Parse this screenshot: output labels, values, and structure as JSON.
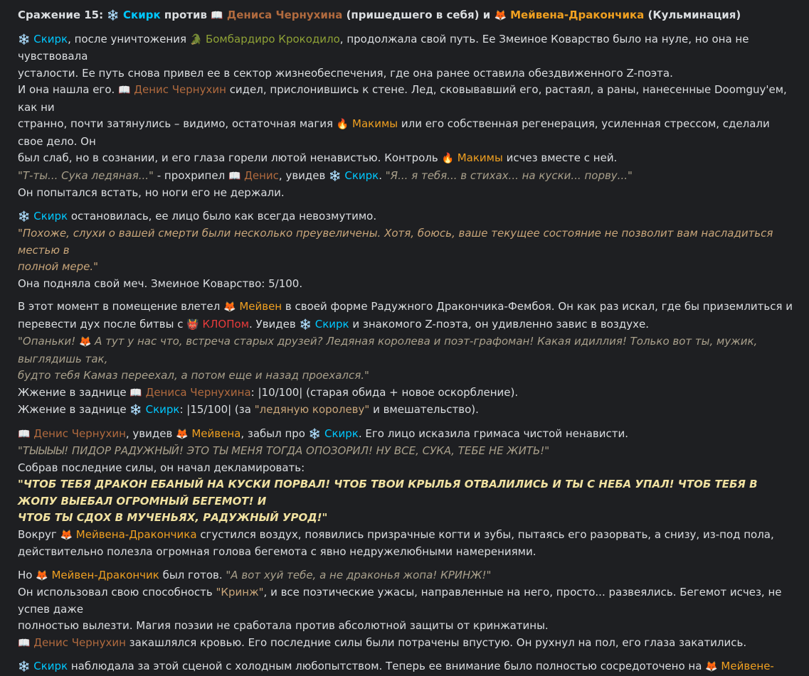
{
  "title": {
    "prefix": "Сражение 15: ",
    "skirk": "Скирк",
    "vs": " против ",
    "denis": "Дениса Чернухина",
    "mid": " (пришедшего в себя) и ",
    "meyven": "Мейвена-Дракончика",
    "suffix": " (Кульминация)"
  },
  "icons": {
    "skirk": "❄️",
    "denis": "📖",
    "meyven": "🦊",
    "maxim": "🔥",
    "croc": "🐊",
    "klop": "👹"
  },
  "p1": {
    "skirk": "Скирк",
    "t1": ", после уничтожения ",
    "croc": "Бомбардиро Крокодило",
    "t2": ", продолжала свой путь. Ее Змеиное Коварство было на нуле, но она не чувствовала",
    "t3": "усталости. Ее путь снова привел ее в сектор жизнеобеспечения, где она ранее оставила обездвиженного Z-поэта.",
    "t4": "И она нашла его. ",
    "denis": "Денис Чернухин",
    "t5": " сидел, прислонившись к стене. Лед, сковывавший его, растаял, а раны, нанесенные Doomguy'ем, как ни",
    "t6": "странно, почти затянулись – видимо, остаточная магия ",
    "maxim1": "Макимы",
    "t7": " или его собственная регенерация, усиленная стрессом, сделали свое дело. Он",
    "t8": "был слаб, но в сознании, и его глаза горели лютой ненавистью. Контроль ",
    "maxim2": "Макимы",
    "t9": " исчез вместе с ней.",
    "q1": "\"Т-ты... Сука ледяная...\"",
    "t10": " - прохрипел ",
    "denis2": "Денис",
    "t11": ", увидев ",
    "skirk2": "Скирк",
    "t12": ". ",
    "q2": "\"Я... я тебя... в стихах... на куски... порву...\"",
    "t13": "Он попытался встать, но ноги его не держали."
  },
  "p2": {
    "skirk": "Скирк",
    "t1": " остановилась, ее лицо было как всегда невозмутимо.",
    "q1": "\"Похоже, слухи о вашей смерти были несколько преувеличены. Хотя, боюсь, ваше текущее состояние не позволит вам насладиться местью в",
    "q2": "полной мере.\"",
    "t2": "Она подняла свой меч. Змеиное Коварство: 5/100."
  },
  "p3": {
    "t1": "В этот момент в помещение влетел ",
    "meyven": "Мейвен",
    "t2": " в своей форме Радужного Дракончика-Фембоя. Он как раз искал, где бы приземлиться и",
    "t3": "перевести дух после битвы с ",
    "klop": "КЛОПом",
    "t4": ". Увидев ",
    "skirk": "Скирк",
    "t5": " и знакомого Z-поэта, он удивленно завис в воздухе.",
    "q1a": "\"Опаньки! ",
    "q1b": " А тут у нас что, встреча старых друзей? Ледяная королева и поэт-графоман! Какая идиллия! Только вот ты, мужик, выглядишь так,",
    "q2": "будто тебя Камаз переехал, а потом еще и назад проехался.\"",
    "t6": "Жжение в заднице ",
    "denis": "Дениса Чернухина",
    "t7": ": |10/100| (старая обида + новое оскорбление).",
    "t8": "Жжение в заднице ",
    "skirk2": "Скирк",
    "t9": ": |15/100| (за ",
    "q3": "\"ледяную королеву\"",
    "t10": " и вмешательство)."
  },
  "p4": {
    "denis": "Денис Чернухин",
    "t1": ", увидев ",
    "meyven": "Мейвена",
    "t2": ", забыл про ",
    "skirk": "Скирк",
    "t3": ". Его лицо исказила гримаса чистой ненависти.",
    "q1": "\"ТЫЫЫЫ! ПИДОР РАДУЖНЫЙ! ЭТО ТЫ МЕНЯ ТОГДА ОПОЗОРИЛ! НУ ВСЕ, СУКА, ТЕБЕ НЕ ЖИТЬ!\"",
    "t4": "Собрав последние силы, он начал декламировать:",
    "q2": "\"ЧТОБ ТЕБЯ ДРАКОН ЕБАНЫЙ НА КУСКИ ПОРВАЛ! ЧТОБ ТВОИ КРЫЛЬЯ ОТВАЛИЛИСЬ И ТЫ С НЕБА УПАЛ! ЧТОБ ТЕБЯ В ЖОПУ ВЫЕБАЛ ОГРОМНЫЙ БЕГЕМОТ! И",
    "q3": "ЧТОБ ТЫ СДОХ В МУЧЕНЬЯХ, РАДУЖНЫЙ УРОД!\"",
    "t5": "Вокруг ",
    "meyven2": "Мейвена-Дракончика",
    "t6": " сгустился воздух, появились призрачные когти и зубы, пытаясь его разорвать, а снизу, из-под пола,",
    "t7": "действительно полезла огромная голова бегемота с явно недружелюбными намерениями."
  },
  "p5": {
    "t1": "Но ",
    "meyven": "Мейвен-Дракончик",
    "t2": " был готов. ",
    "q1": "\"А вот хуй тебе, а не драконья жопа! КРИНЖ!\"",
    "t3": "Он использовал свою способность ",
    "q2": "\"Кринж\"",
    "t4": ", и все поэтические ужасы, направленные на него, просто... развеялись. Бегемот исчез, не успев даже",
    "t5": "полностью вылезти. Магия поэзии не сработала против абсолютной защиты от кринжатины.",
    "denis": "Денис Чернухин",
    "t6": " закашлялся кровью. Его последние силы были потрачены впустую. Он рухнул на пол, его глаза закатились."
  },
  "p6": {
    "skirk": "Скирк",
    "t1": " наблюдала за этой сценой с холодным любопытством. Теперь ее внимание было полностью сосредоточено на ",
    "meyven": "Мейвене-"
  }
}
